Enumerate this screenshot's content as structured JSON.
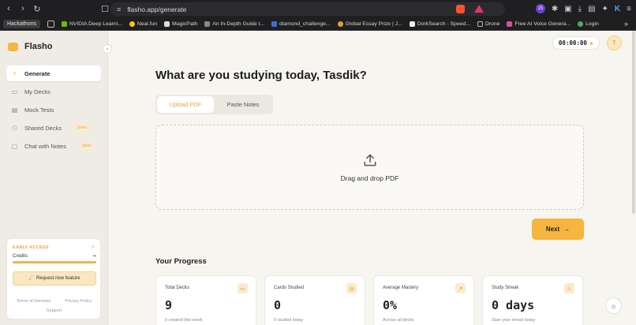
{
  "browser": {
    "url": "flasho.app/generate",
    "bookmarks_chip": "Hackathons",
    "bookmarks": [
      {
        "label": "NVIDIA Deep Learni...",
        "color": "#76b900"
      },
      {
        "label": "Neal.fun",
        "color": "#f5c518"
      },
      {
        "label": "MagicPath",
        "color": "#dddddd"
      },
      {
        "label": "An In-Depth Guide t...",
        "color": "#888888"
      },
      {
        "label": "diamond_challenge...",
        "color": "#3b6fd8"
      },
      {
        "label": "Global Essay Prize | J...",
        "color": "#e0a030"
      },
      {
        "label": "DorkSearch - Speed...",
        "color": "#eeeeee"
      },
      {
        "label": "Drone",
        "color": "#aaaaaa"
      },
      {
        "label": "Free AI Voice Genera...",
        "color": "#d84fa0"
      },
      {
        "label": "Login",
        "color": "#4caf50"
      }
    ],
    "badge_count": "15"
  },
  "sidebar": {
    "brand": "Flasho",
    "items": [
      {
        "label": "Generate",
        "icon": "⚡"
      },
      {
        "label": "My Decks",
        "icon": "▭"
      },
      {
        "label": "Mock Tests",
        "icon": "▤"
      },
      {
        "label": "Shared Decks",
        "icon": "⚇",
        "badge": "Soon"
      },
      {
        "label": "Chat with Notes",
        "icon": "▢",
        "badge": "Soon"
      }
    ],
    "early_access": {
      "title": "EARLY ACCESS",
      "credits_label": "Credits",
      "credits_value": "∞",
      "credits_fraction": 1.0,
      "request_label": "Request new feature"
    },
    "footer": {
      "terms": "Terms of Services",
      "privacy": "Privacy Policy",
      "support": "Support"
    }
  },
  "header": {
    "timer": "00:00:00",
    "avatar_initial": "T"
  },
  "main": {
    "headline": "What are you studying today, Tasdik?",
    "tabs": [
      {
        "label": "Upload PDF"
      },
      {
        "label": "Paste Notes"
      }
    ],
    "dropzone_label": "Drag and drop PDF",
    "next_label": "Next",
    "progress_title": "Your Progress",
    "stats": [
      {
        "label": "Total Decks",
        "value": "9",
        "sub": "0 created this week",
        "icon": "book-icon"
      },
      {
        "label": "Cards Studied",
        "value": "0",
        "sub": "0 studied today",
        "icon": "target-icon"
      },
      {
        "label": "Average Mastery",
        "value": "0%",
        "sub": "Across all decks",
        "icon": "trend-icon"
      },
      {
        "label": "Study Streak",
        "value": "0 days",
        "sub": "Start your streak today",
        "icon": "flame-icon"
      }
    ]
  },
  "colors": {
    "accent": "#f5b53f",
    "accent_text": "#e8a33a"
  }
}
